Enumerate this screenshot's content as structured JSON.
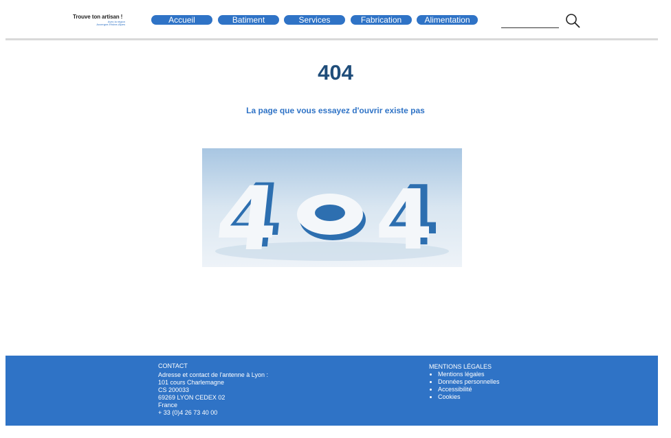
{
  "logo": {
    "line1": "Trouve ton artisan !",
    "line2": "Avec la région",
    "line3": "Auvergne-Rhône-Alpes"
  },
  "nav": [
    {
      "label": "Accueil"
    },
    {
      "label": "Batiment"
    },
    {
      "label": "Services"
    },
    {
      "label": "Fabrication"
    },
    {
      "label": "Alimentation"
    }
  ],
  "search": {
    "placeholder": "",
    "icon": "search-icon"
  },
  "main": {
    "title": "404",
    "message": "La page que vous essayez d'ouvrir existe pas",
    "image_text": "404"
  },
  "footer": {
    "contact_title": "CONTACT",
    "contact_lines": [
      "Adresse et contact de l'antenne à Lyon :",
      "101 cours Charlemagne",
      "CS 200033",
      "69269 LYON CEDEX 02",
      "France",
      "+ 33 (0)4 26 73 40 00"
    ],
    "legal_title": "MENTIONS LÉGALES",
    "legal_links": [
      "Mentions légales",
      "Données personnelles",
      "Accessibilité",
      "Cookies"
    ]
  },
  "colors": {
    "brand": "#2f73c6",
    "title": "#1f4d7a"
  }
}
